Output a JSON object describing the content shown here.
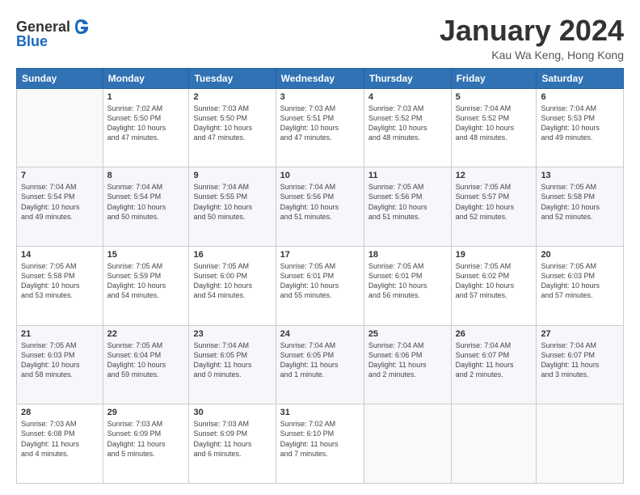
{
  "header": {
    "logo_general": "General",
    "logo_blue": "Blue",
    "title": "January 2024",
    "location": "Kau Wa Keng, Hong Kong"
  },
  "days_of_week": [
    "Sunday",
    "Monday",
    "Tuesday",
    "Wednesday",
    "Thursday",
    "Friday",
    "Saturday"
  ],
  "weeks": [
    [
      {
        "day": "",
        "content": ""
      },
      {
        "day": "1",
        "content": "Sunrise: 7:02 AM\nSunset: 5:50 PM\nDaylight: 10 hours\nand 47 minutes."
      },
      {
        "day": "2",
        "content": "Sunrise: 7:03 AM\nSunset: 5:50 PM\nDaylight: 10 hours\nand 47 minutes."
      },
      {
        "day": "3",
        "content": "Sunrise: 7:03 AM\nSunset: 5:51 PM\nDaylight: 10 hours\nand 47 minutes."
      },
      {
        "day": "4",
        "content": "Sunrise: 7:03 AM\nSunset: 5:52 PM\nDaylight: 10 hours\nand 48 minutes."
      },
      {
        "day": "5",
        "content": "Sunrise: 7:04 AM\nSunset: 5:52 PM\nDaylight: 10 hours\nand 48 minutes."
      },
      {
        "day": "6",
        "content": "Sunrise: 7:04 AM\nSunset: 5:53 PM\nDaylight: 10 hours\nand 49 minutes."
      }
    ],
    [
      {
        "day": "7",
        "content": "Sunrise: 7:04 AM\nSunset: 5:54 PM\nDaylight: 10 hours\nand 49 minutes."
      },
      {
        "day": "8",
        "content": "Sunrise: 7:04 AM\nSunset: 5:54 PM\nDaylight: 10 hours\nand 50 minutes."
      },
      {
        "day": "9",
        "content": "Sunrise: 7:04 AM\nSunset: 5:55 PM\nDaylight: 10 hours\nand 50 minutes."
      },
      {
        "day": "10",
        "content": "Sunrise: 7:04 AM\nSunset: 5:56 PM\nDaylight: 10 hours\nand 51 minutes."
      },
      {
        "day": "11",
        "content": "Sunrise: 7:05 AM\nSunset: 5:56 PM\nDaylight: 10 hours\nand 51 minutes."
      },
      {
        "day": "12",
        "content": "Sunrise: 7:05 AM\nSunset: 5:57 PM\nDaylight: 10 hours\nand 52 minutes."
      },
      {
        "day": "13",
        "content": "Sunrise: 7:05 AM\nSunset: 5:58 PM\nDaylight: 10 hours\nand 52 minutes."
      }
    ],
    [
      {
        "day": "14",
        "content": "Sunrise: 7:05 AM\nSunset: 5:58 PM\nDaylight: 10 hours\nand 53 minutes."
      },
      {
        "day": "15",
        "content": "Sunrise: 7:05 AM\nSunset: 5:59 PM\nDaylight: 10 hours\nand 54 minutes."
      },
      {
        "day": "16",
        "content": "Sunrise: 7:05 AM\nSunset: 6:00 PM\nDaylight: 10 hours\nand 54 minutes."
      },
      {
        "day": "17",
        "content": "Sunrise: 7:05 AM\nSunset: 6:01 PM\nDaylight: 10 hours\nand 55 minutes."
      },
      {
        "day": "18",
        "content": "Sunrise: 7:05 AM\nSunset: 6:01 PM\nDaylight: 10 hours\nand 56 minutes."
      },
      {
        "day": "19",
        "content": "Sunrise: 7:05 AM\nSunset: 6:02 PM\nDaylight: 10 hours\nand 57 minutes."
      },
      {
        "day": "20",
        "content": "Sunrise: 7:05 AM\nSunset: 6:03 PM\nDaylight: 10 hours\nand 57 minutes."
      }
    ],
    [
      {
        "day": "21",
        "content": "Sunrise: 7:05 AM\nSunset: 6:03 PM\nDaylight: 10 hours\nand 58 minutes."
      },
      {
        "day": "22",
        "content": "Sunrise: 7:05 AM\nSunset: 6:04 PM\nDaylight: 10 hours\nand 59 minutes."
      },
      {
        "day": "23",
        "content": "Sunrise: 7:04 AM\nSunset: 6:05 PM\nDaylight: 11 hours\nand 0 minutes."
      },
      {
        "day": "24",
        "content": "Sunrise: 7:04 AM\nSunset: 6:05 PM\nDaylight: 11 hours\nand 1 minute."
      },
      {
        "day": "25",
        "content": "Sunrise: 7:04 AM\nSunset: 6:06 PM\nDaylight: 11 hours\nand 2 minutes."
      },
      {
        "day": "26",
        "content": "Sunrise: 7:04 AM\nSunset: 6:07 PM\nDaylight: 11 hours\nand 2 minutes."
      },
      {
        "day": "27",
        "content": "Sunrise: 7:04 AM\nSunset: 6:07 PM\nDaylight: 11 hours\nand 3 minutes."
      }
    ],
    [
      {
        "day": "28",
        "content": "Sunrise: 7:03 AM\nSunset: 6:08 PM\nDaylight: 11 hours\nand 4 minutes."
      },
      {
        "day": "29",
        "content": "Sunrise: 7:03 AM\nSunset: 6:09 PM\nDaylight: 11 hours\nand 5 minutes."
      },
      {
        "day": "30",
        "content": "Sunrise: 7:03 AM\nSunset: 6:09 PM\nDaylight: 11 hours\nand 6 minutes."
      },
      {
        "day": "31",
        "content": "Sunrise: 7:02 AM\nSunset: 6:10 PM\nDaylight: 11 hours\nand 7 minutes."
      },
      {
        "day": "",
        "content": ""
      },
      {
        "day": "",
        "content": ""
      },
      {
        "day": "",
        "content": ""
      }
    ]
  ]
}
